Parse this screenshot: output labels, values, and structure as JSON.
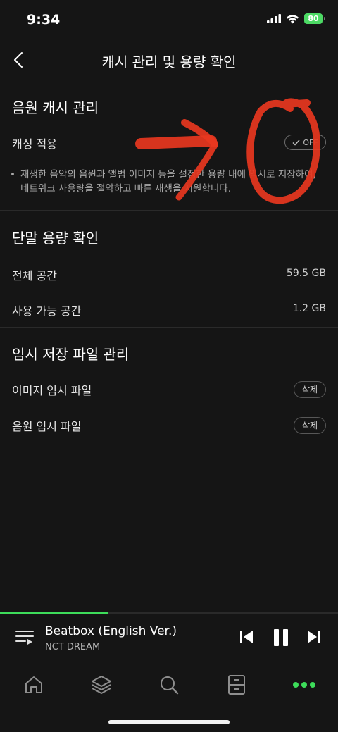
{
  "status_bar": {
    "time": "9:34",
    "battery": "80"
  },
  "header": {
    "title": "캐시 관리 및 용량 확인"
  },
  "cache_section": {
    "title": "음원 캐시 관리",
    "caching_label": "캐싱 적용",
    "toggle_label": "OFF",
    "note": "재생한 음악의 음원과 앨범 이미지 등을 설정한 용량 내에 임시로 저장하여, 네트워크 사용량을 절약하고 빠른 재생을 지원합니다."
  },
  "storage_section": {
    "title": "단말 용량 확인",
    "rows": [
      {
        "label": "전체 공간",
        "value": "59.5 GB"
      },
      {
        "label": "사용 가능 공간",
        "value": "1.2 GB"
      }
    ]
  },
  "temp_section": {
    "title": "임시 저장 파일 관리",
    "rows": [
      {
        "label": "이미지 임시 파일",
        "action": "삭제"
      },
      {
        "label": "음원 임시 파일",
        "action": "삭제"
      }
    ]
  },
  "player": {
    "title": "Beatbox (English Ver.)",
    "artist": "NCT DREAM",
    "progress": 0.32
  },
  "colors": {
    "accent": "#3ddc5a",
    "annotation": "#e8371f",
    "background": "#151515"
  }
}
